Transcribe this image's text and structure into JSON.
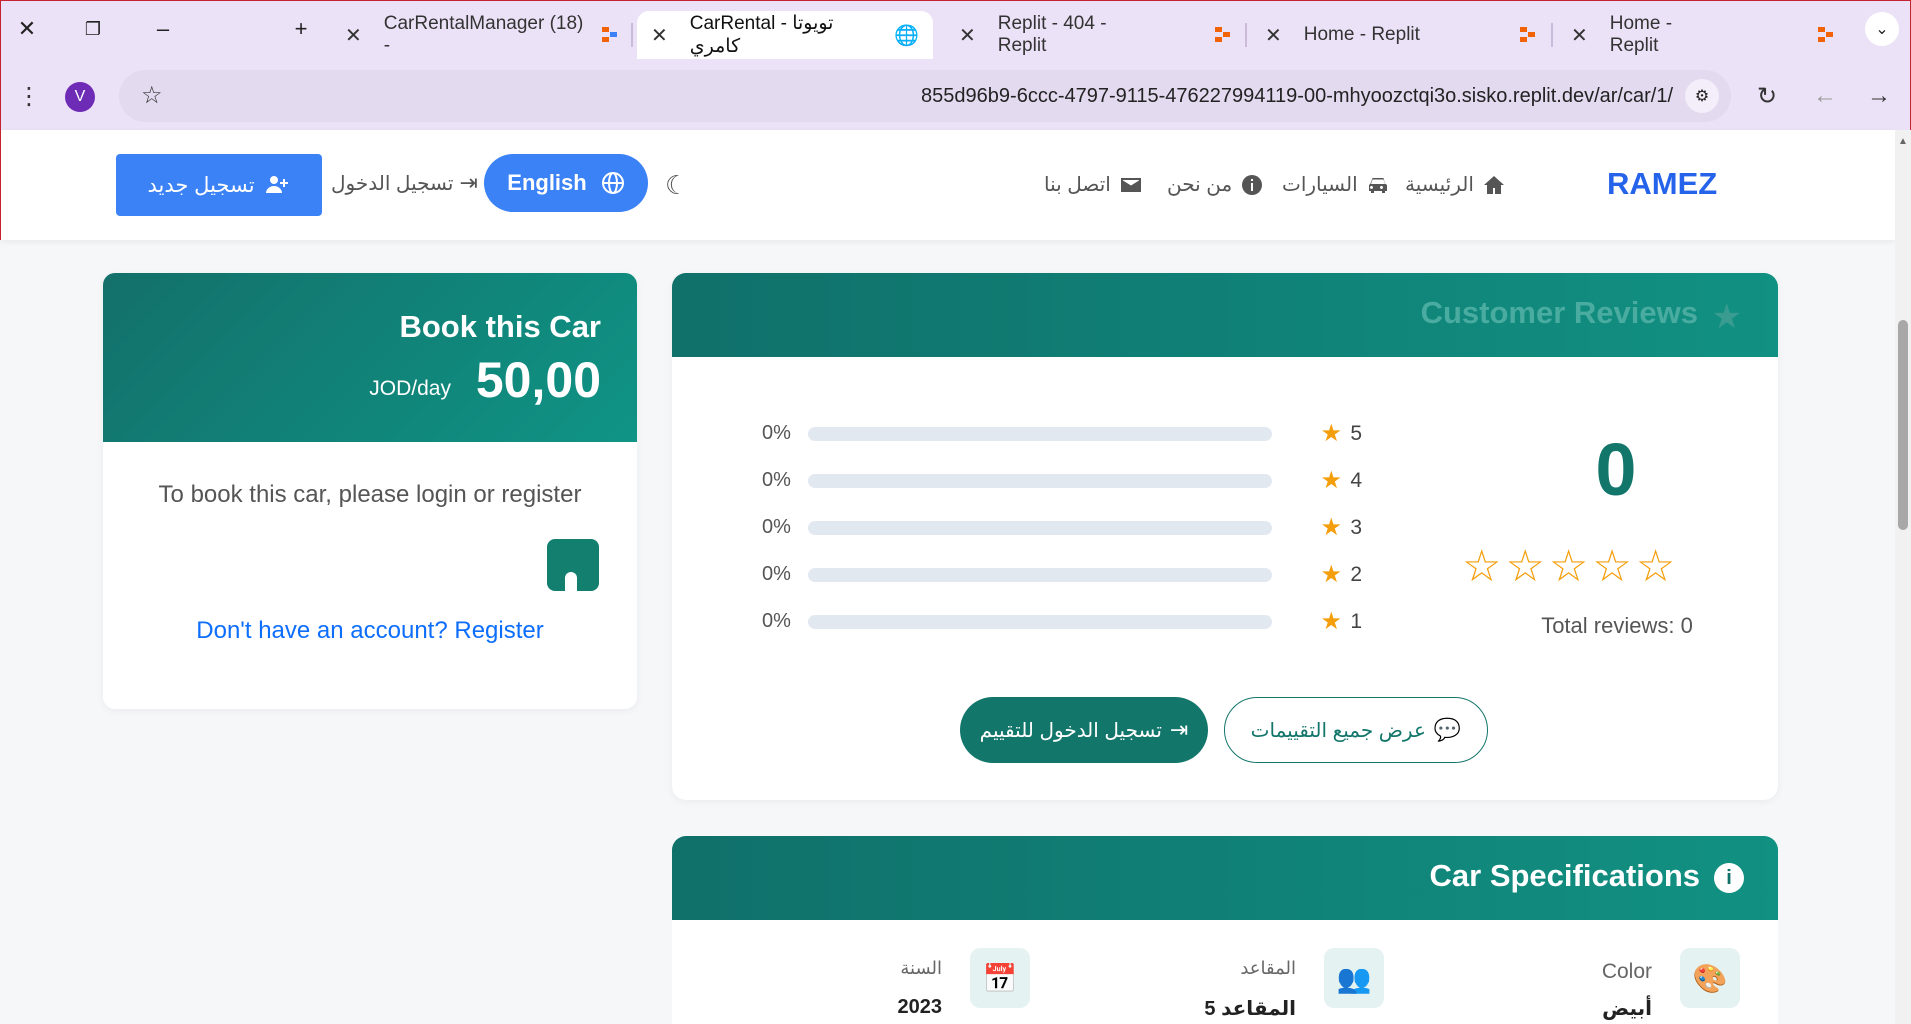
{
  "browser": {
    "tabs": [
      {
        "title": "CarRentalManager (18) -"
      },
      {
        "title": "CarRental - تويوتا كامري"
      },
      {
        "title": "Replit - 404 - Replit"
      },
      {
        "title": "Home - Replit"
      },
      {
        "title": "Home - Replit"
      }
    ],
    "url": "855d96b9-6ccc-4797-9115-476227994119-00-mhyoozctqi3o.sisko.replit.dev/ar/car/1/",
    "profile_initial": "V"
  },
  "header": {
    "brand": "RAMEZ",
    "nav": {
      "home": "الرئيسية",
      "cars": "السيارات",
      "about": "من نحن",
      "contact": "اتصل بنا"
    },
    "language_button": "English",
    "login": "تسجيل الدخول",
    "register": "تسجيل جديد"
  },
  "booking": {
    "title": "Book this Car",
    "price": "50,00",
    "unit": "JOD/day",
    "message": "To book this car, please login or register",
    "register_link": "Don't have an account? Register"
  },
  "reviews": {
    "title": "Customer Reviews",
    "average": "0",
    "average_stars": 0,
    "total": "Total reviews: 0",
    "breakdown": [
      {
        "stars": "5",
        "percent": "0%",
        "fraction": 0
      },
      {
        "stars": "4",
        "percent": "0%",
        "fraction": 0
      },
      {
        "stars": "3",
        "percent": "0%",
        "fraction": 0
      },
      {
        "stars": "2",
        "percent": "0%",
        "fraction": 0
      },
      {
        "stars": "1",
        "percent": "0%",
        "fraction": 0
      }
    ],
    "view_all": "عرض جميع التقييمات",
    "login_to_rate": "تسجيل الدخول للتقييم"
  },
  "specs": {
    "title": "Car Specifications",
    "items": [
      {
        "label": "Color",
        "value": "أبيض"
      },
      {
        "label": "المقاعد",
        "value": "5 المقاعد"
      },
      {
        "label": "السنة",
        "value": "2023"
      }
    ]
  },
  "colors": {
    "primary": "#3b82f6",
    "teal": "#13766b",
    "star": "#f59e0b"
  }
}
